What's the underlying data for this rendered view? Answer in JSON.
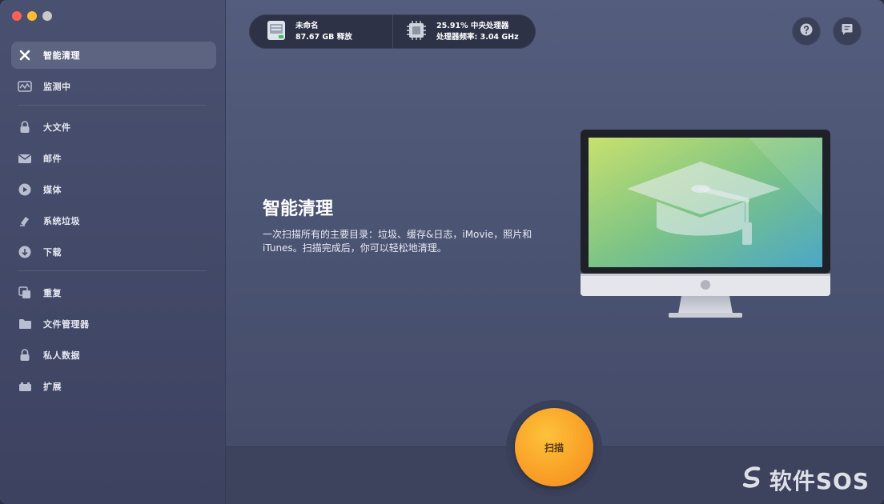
{
  "sidebar": {
    "items": [
      {
        "label": "智能清理",
        "icon": "x-icon",
        "active": true
      },
      {
        "label": "监测中",
        "icon": "monitor-icon"
      },
      {
        "label": "大文件",
        "icon": "lock-icon"
      },
      {
        "label": "邮件",
        "icon": "mail-icon"
      },
      {
        "label": "媒体",
        "icon": "play-icon"
      },
      {
        "label": "系统垃圾",
        "icon": "eraser-icon"
      },
      {
        "label": "下载",
        "icon": "download-icon"
      },
      {
        "label": "重复",
        "icon": "duplicate-icon"
      },
      {
        "label": "文件管理器",
        "icon": "folder-icon"
      },
      {
        "label": "私人数据",
        "icon": "lock-icon"
      },
      {
        "label": "扩展",
        "icon": "extension-icon"
      }
    ]
  },
  "status": {
    "disk_name": "未命名",
    "disk_free": "87.67 GB 释放",
    "cpu_usage": "25.91% 中央处理器",
    "cpu_freq": "处理器频率: 3.04 GHz"
  },
  "main": {
    "title": "智能清理",
    "description": "一次扫描所有的主要目录：垃圾、缓存&日志，iMovie，照片和iTunes。扫描完成后，你可以轻松地清理。",
    "scan_label": "扫描"
  },
  "watermark": "软件SOS",
  "colors": {
    "accent": "#f9a228",
    "sidebar_active": "#5d6482"
  }
}
